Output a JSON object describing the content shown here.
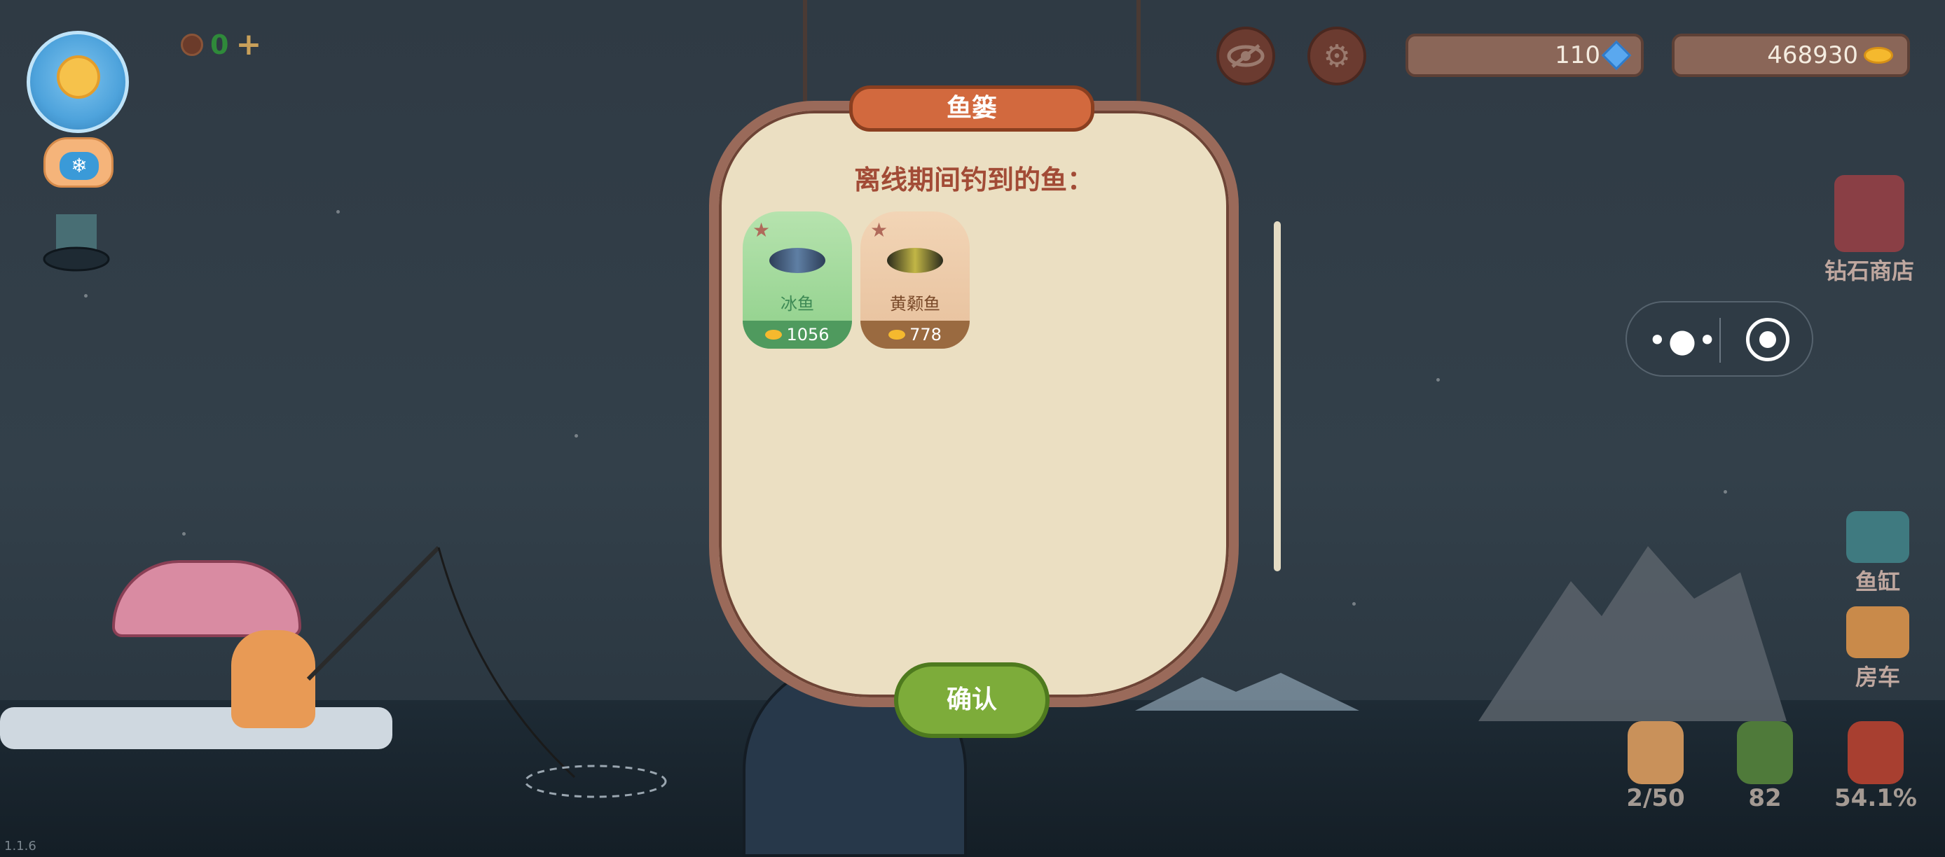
{
  "hud": {
    "cookie_count": "0",
    "plus": "+",
    "gems": "110",
    "coins": "468930"
  },
  "capsule": {
    "more": "•●•"
  },
  "side_menu": {
    "diamond_shop": "钻石商店",
    "fish_tank": "鱼缸",
    "rv": "房车"
  },
  "bottom_bar": {
    "bag": "2/50",
    "backpack": "82",
    "collection": "54.1%"
  },
  "panel": {
    "title": "鱼篓",
    "subtitle": "离线期间钓到的鱼：",
    "confirm": "确认",
    "fish": [
      {
        "name": "冰鱼",
        "price": "1056",
        "star": "★"
      },
      {
        "name": "黄颡鱼",
        "price": "778",
        "star": "★"
      }
    ]
  },
  "version": "1.1.6",
  "colors": {
    "accent_orange": "#d2693e",
    "confirm_green": "#7dac3a",
    "panel_bg": "#ebdfc2",
    "card_green": "#8fd08a",
    "card_tan": "#e7c09c"
  },
  "icons": [
    "sun-avatar-icon",
    "snowflake-icon",
    "cookie-icon",
    "eye-icon",
    "gear-icon",
    "gem-icon",
    "fish-coin-icon",
    "more-icon",
    "target-icon",
    "star-icon"
  ]
}
